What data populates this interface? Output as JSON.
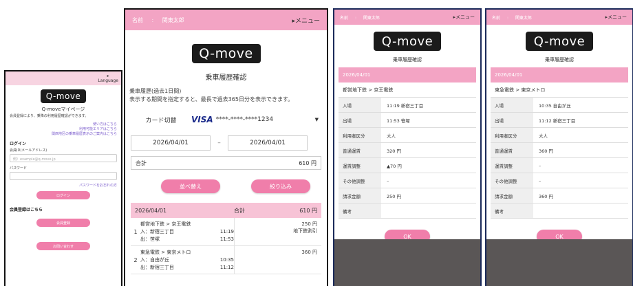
{
  "login": {
    "language": "Language",
    "logo": "Q-move",
    "title": "Q-moveマイページ",
    "desc": "会員登録により、乗降の利用履歴確認ができます。",
    "links": [
      "使い方はこちら",
      "利用可能エリアはこちら",
      "関西地区の乗車履歴表示のご案内はこちら"
    ],
    "login_heading": "ログイン",
    "id_label": "会員ID(メールアドレス)",
    "id_placeholder": "例）example@q-move.jp",
    "pw_label": "パスワード",
    "forgot": "パスワードをお忘れの方",
    "login_btn": "ログイン",
    "register_heading": "会員登録はこちら",
    "register_btn": "会員登録",
    "contact_btn": "お問い合わせ"
  },
  "history": {
    "user_label": "名前",
    "user_name": "関東太郎",
    "menu": "▸メニュー",
    "logo": "Q-move",
    "title": "乗車履歴確認",
    "sub1": "乗車履歴(過去1日間)",
    "sub2": "表示する期間を指定すると、最長で過去365日分を表示できます。",
    "card_label": "カード切替",
    "card_brand": "VISA",
    "card_number": "****-****-****1234",
    "date_from": "2026/04/01",
    "date_sep": "–",
    "date_to": "2026/04/01",
    "total_label": "合計",
    "total_value": "610 円",
    "sort_btn": "並べ替え",
    "filter_btn": "絞り込み",
    "group_date": "2026/04/01",
    "group_total_label": "合計",
    "group_total": "610 円",
    "trips": [
      {
        "no": "1",
        "route": "都営地下鉄 > 京王電鉄",
        "in": "入：新宿三丁目",
        "in_time": "11:19",
        "out": "出：笹塚",
        "out_time": "11:53",
        "fare": "250 円",
        "note": "地下鉄割引"
      },
      {
        "no": "2",
        "route": "東急電鉄 > 東京メトロ",
        "in": "入：自由が丘",
        "in_time": "10:35",
        "out": "出：新宿三丁目",
        "out_time": "11:12",
        "fare": "360 円",
        "note": ""
      }
    ]
  },
  "labels": {
    "entry": "入場",
    "exit": "出場",
    "user_type": "利用者区分",
    "normal_fare": "普通運賃",
    "fare_adjust": "運賃調整",
    "other_adjust": "その他調整",
    "charge": "請求金額",
    "remarks": "備考"
  },
  "detail1": {
    "user_label": "名前",
    "user_name": "関東太郎",
    "menu": "▸メニュー",
    "logo": "Q-move",
    "title": "乗車履歴確認",
    "date": "2026/04/01",
    "route": "都営地下鉄 > 京王電鉄",
    "entry": "11:19 新宿三丁目",
    "exit": "11:53 笹塚",
    "user_type": "大人",
    "normal_fare": "320 円",
    "fare_adjust": "▲70 円",
    "other_adjust": "–",
    "charge": "250 円",
    "remarks": "",
    "ok": "OK"
  },
  "detail2": {
    "user_label": "名前",
    "user_name": "関東太郎",
    "menu": "▸メニュー",
    "logo": "Q-move",
    "title": "乗車履歴確認",
    "date": "2026/04/01",
    "route": "東急電鉄 > 東京メトロ",
    "entry": "10:35 自由が丘",
    "exit": "11:12 新宿三丁目",
    "user_type": "大人",
    "normal_fare": "360 円",
    "fare_adjust": "–",
    "other_adjust": "–",
    "charge": "360 円",
    "remarks": "",
    "ok": "OK"
  },
  "colors": {
    "pink_header": "#f3a4c4",
    "pink_button": "#f07eaa",
    "pink_light": "#f7c3d6",
    "logo_bg": "#1b1b1b"
  }
}
